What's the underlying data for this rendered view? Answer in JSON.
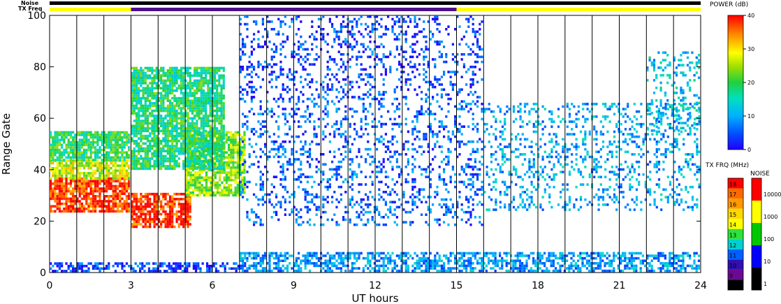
{
  "chart_data": {
    "type": "heatmap",
    "xlabel": "UT hours",
    "ylabel": "Range Gate",
    "xlim": [
      0,
      24
    ],
    "ylim": [
      0,
      100
    ],
    "x_ticks": [
      "0",
      "3",
      "6",
      "9",
      "12",
      "15",
      "18",
      "21",
      "24"
    ],
    "y_ticks": [
      "0",
      "20",
      "40",
      "60",
      "80",
      "100"
    ],
    "vertical_scan_lines_every_hours": 1,
    "top_strips": {
      "noise_label": "Noise",
      "txfreq_label": "TX Freq",
      "noise_color": "#000000",
      "txfreq_segments": [
        {
          "from": 0,
          "to": 3,
          "color": "#ffff00"
        },
        {
          "from": 3,
          "to": 15,
          "color": "#4b0f8c"
        },
        {
          "from": 15,
          "to": 24,
          "color": "#ffff00"
        }
      ]
    },
    "power_scale": {
      "title": "POWER (dB)",
      "ticks": [
        "40",
        "30",
        "20",
        "10",
        "0"
      ],
      "range": [
        0,
        40
      ]
    },
    "txfreq_scale": {
      "title": "TX FRQ (MHz)",
      "ticks": [
        "18",
        "17",
        "16",
        "15",
        "14",
        "13",
        "12",
        "11",
        "10",
        "9"
      ],
      "colors": [
        "#ff0000",
        "#ff6a00",
        "#ff9a00",
        "#ffd800",
        "#ffff00",
        "#30e040",
        "#00d0d0",
        "#0060ff",
        "#3010b0",
        "#6a0a90",
        "#000000"
      ]
    },
    "noise_scale": {
      "title": "NOISE",
      "ticks": [
        "10000",
        "1000",
        "100",
        "10",
        "1"
      ],
      "colors": [
        "#ff0000",
        "#ffff00",
        "#00c800",
        "#0000ff",
        "#000000"
      ]
    },
    "bands": [
      {
        "name": "",
        "t0": 0.0,
        "t1": 3.0,
        "r_lo": 23,
        "r_hi": 37,
        "power": 38
      },
      {
        "name": "",
        "t0": 0.0,
        "t1": 3.0,
        "r_lo": 36,
        "r_hi": 44,
        "power": 27
      },
      {
        "name": "",
        "t0": 0.0,
        "t1": 3.0,
        "r_lo": 43,
        "r_hi": 55,
        "power": 19
      },
      {
        "name": "",
        "t0": 3.0,
        "t1": 5.2,
        "r_lo": 17,
        "r_hi": 31,
        "power": 38
      },
      {
        "name": "",
        "t0": 5.0,
        "t1": 7.2,
        "r_lo": 30,
        "r_hi": 55,
        "power": 24
      },
      {
        "name": "",
        "t0": 3.0,
        "t1": 6.5,
        "r_lo": 40,
        "r_hi": 80,
        "power": 18
      },
      {
        "name": "",
        "t0": 7.0,
        "t1": 16.0,
        "r_lo": 18,
        "r_hi": 68,
        "power": 6
      },
      {
        "name": "",
        "t0": 7.0,
        "t1": 16.0,
        "r_lo": 68,
        "r_hi": 100,
        "power": 4
      },
      {
        "name": "",
        "t0": 16.0,
        "t1": 24.0,
        "r_lo": 24,
        "r_hi": 66,
        "power": 10
      },
      {
        "name": "",
        "t0": 22.0,
        "t1": 24.0,
        "r_lo": 55,
        "r_hi": 86,
        "power": 12
      },
      {
        "name": "",
        "t0": 7.0,
        "t1": 24.0,
        "r_lo": 0,
        "r_hi": 8,
        "power": 9
      },
      {
        "name": "",
        "t0": 0.0,
        "t1": 7.0,
        "r_lo": 0,
        "r_hi": 4,
        "power": 4
      }
    ]
  }
}
